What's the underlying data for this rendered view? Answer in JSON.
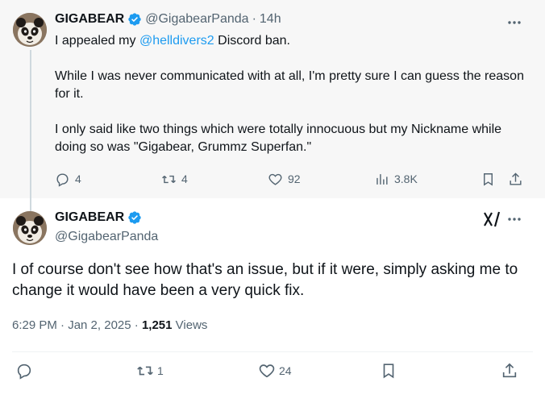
{
  "parent_tweet": {
    "display_name": "GIGABEAR",
    "handle": "@GigabearPanda",
    "separator": "·",
    "time": "14h",
    "text_line1_prefix": "I appealed my ",
    "mention": "@helldivers2",
    "text_line1_suffix": " Discord ban.",
    "text_paragraph2": "While I was never communicated with at all, I'm pretty sure I can guess the reason for it.",
    "text_paragraph3": "I only said like two things which were totally innocuous but my Nickname while doing so was \"Gigabear, Grummz Superfan.\"",
    "replies": "4",
    "reposts": "4",
    "likes": "92",
    "views": "3.8K",
    "more_icon": "more-horizontal-icon"
  },
  "reply_tweet": {
    "display_name": "GIGABEAR",
    "handle": "@GigabearPanda",
    "text": "I of course don't see how that's an issue, but if it were, simply asking me to change it would have been a very quick fix.",
    "timestamp": "6:29 PM · Jan 2, 2025",
    "separator": "·",
    "views_count": "1,251",
    "views_label": "Views",
    "reposts": "1",
    "likes": "24"
  },
  "colors": {
    "accent": "#1d9bf0",
    "text_primary": "#0f1419",
    "text_secondary": "#536471",
    "parent_background": "#f7f7f7"
  }
}
